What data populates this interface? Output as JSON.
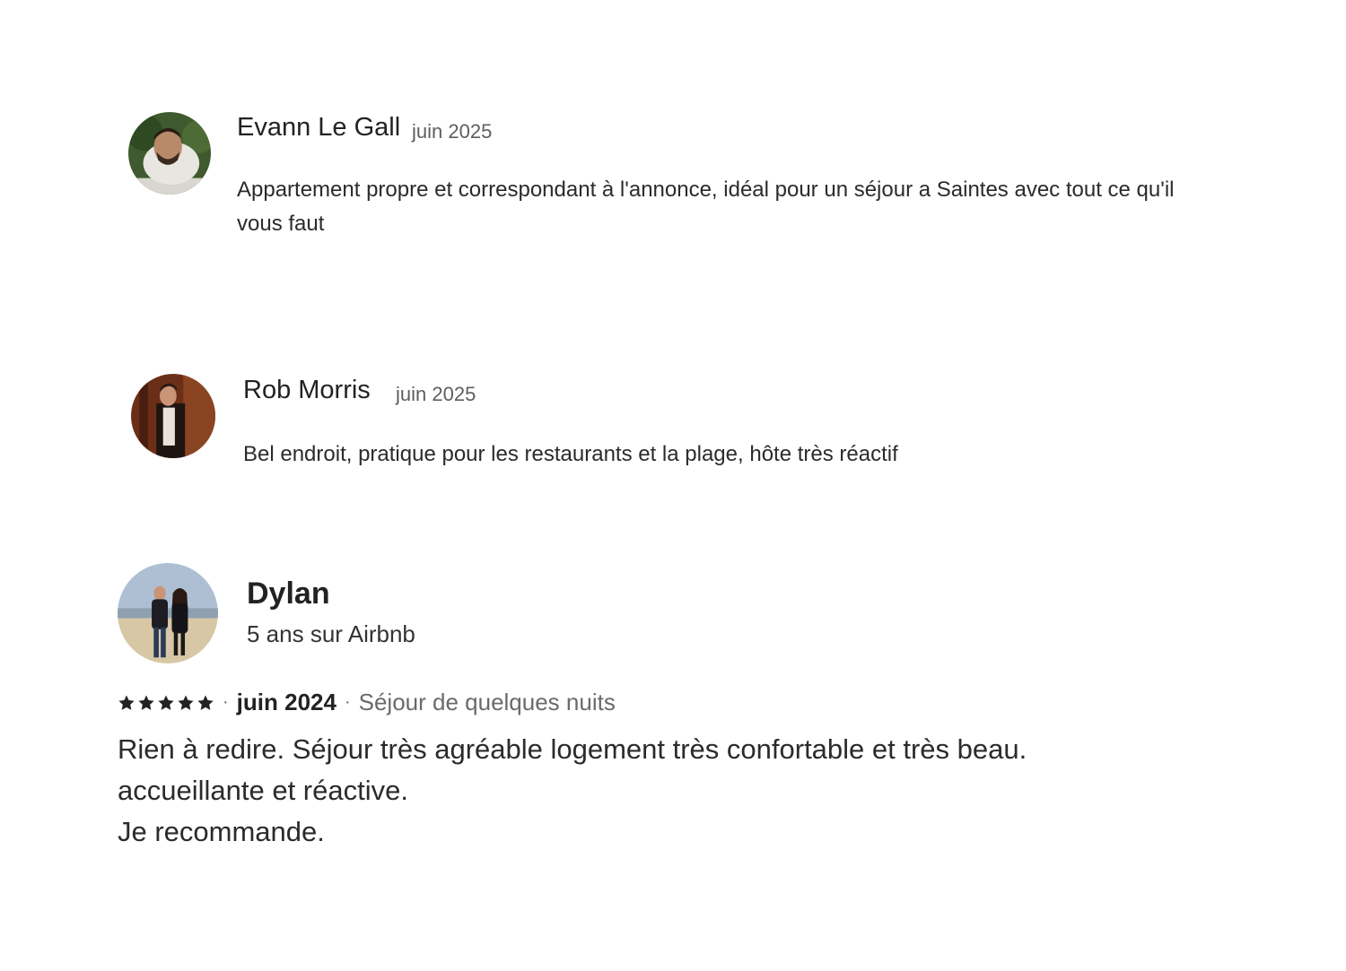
{
  "reviews": [
    {
      "name": "Evann Le Gall",
      "date": "juin 2025",
      "text": "Appartement propre et correspondant à l'annonce, idéal pour un séjour a Saintes avec tout ce qu'il vous faut"
    },
    {
      "name": "Rob Morris",
      "date": "juin 2025",
      "text": "Bel endroit, pratique pour les restaurants et la plage, hôte très réactif"
    },
    {
      "name": "Dylan",
      "tenure": "5 ans sur Airbnb",
      "rating": 5,
      "separator": "·",
      "date": "juin 2024",
      "stay": "Séjour de quelques nuits",
      "text_lines": [
        "Rien à redire. Séjour très agréable logement très confortable et très beau.",
        "accueillante et réactive.",
        "Je recommande."
      ]
    }
  ],
  "colors": {
    "text": "#222222",
    "muted": "#6a6a6a",
    "star": "#222222"
  }
}
